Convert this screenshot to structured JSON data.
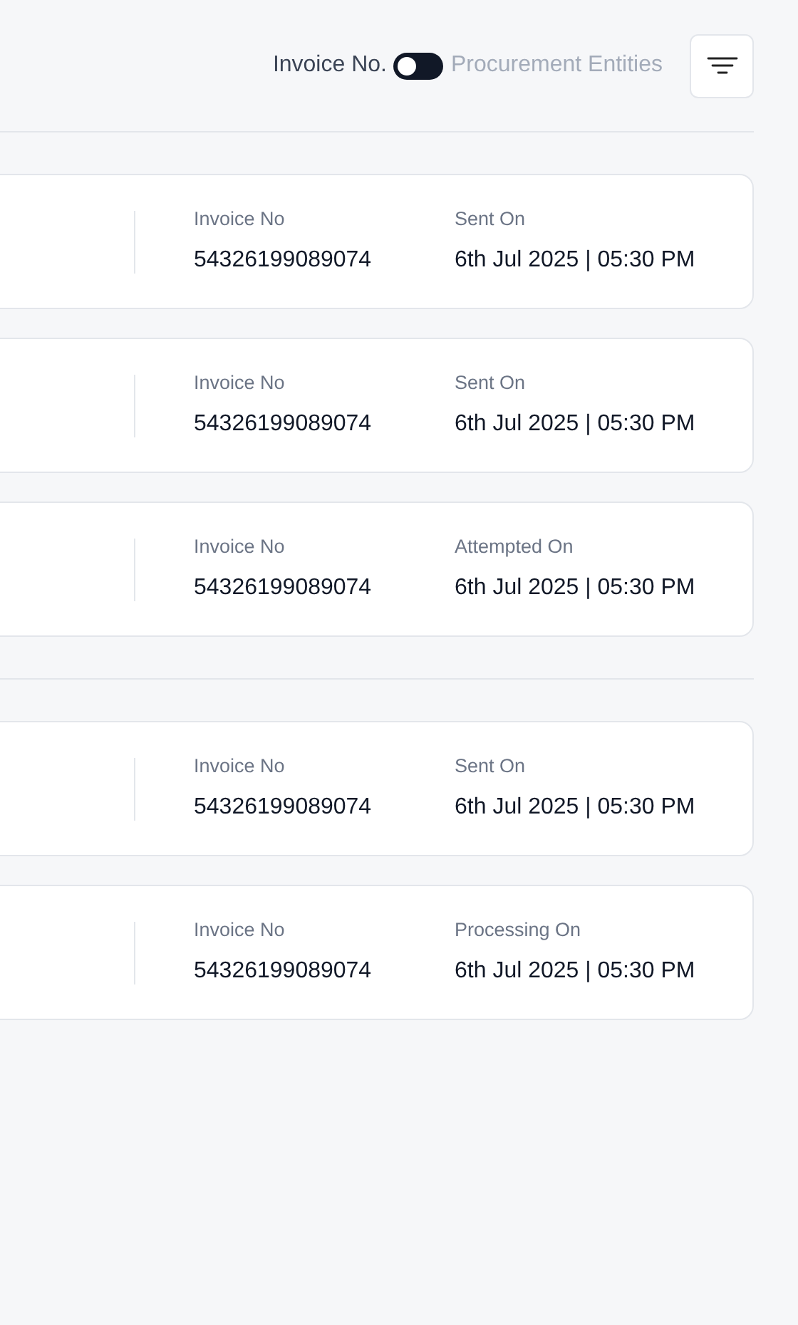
{
  "view_toggle": {
    "options": [
      {
        "label": "Invoice No.",
        "selected": true
      },
      {
        "label": "Procurement Entities",
        "selected": false
      }
    ]
  },
  "groups": [
    {
      "cards": [
        {
          "invoice_label": "Invoice No",
          "invoice_no": "54326199089074",
          "date_label": "Sent On",
          "date": "6th Jul 2025 | 05:30 PM"
        },
        {
          "invoice_label": "Invoice No",
          "invoice_no": "54326199089074",
          "date_label": "Sent On",
          "date": "6th Jul 2025 | 05:30 PM"
        },
        {
          "invoice_label": "Invoice No",
          "invoice_no": "54326199089074",
          "date_label": "Attempted On",
          "date": "6th Jul 2025 | 05:30 PM"
        }
      ]
    },
    {
      "cards": [
        {
          "invoice_label": "Invoice No",
          "invoice_no": "54326199089074",
          "date_label": "Sent On",
          "date": "6th Jul 2025 | 05:30 PM"
        },
        {
          "invoice_label": "Invoice No",
          "invoice_no": "54326199089074",
          "date_label": "Processing On",
          "date": "6th Jul 2025 | 05:30 PM"
        }
      ]
    }
  ]
}
